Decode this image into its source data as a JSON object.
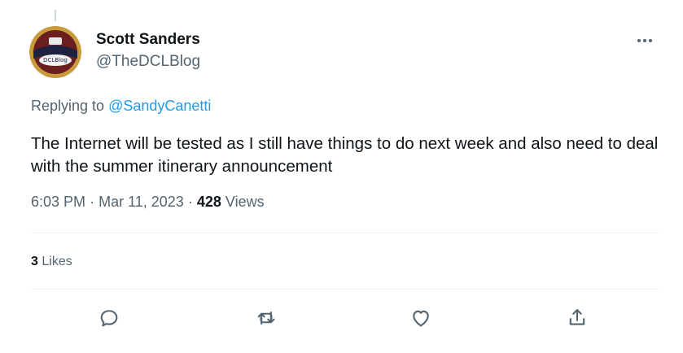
{
  "author": {
    "name": "Scott Sanders",
    "handle": "@TheDCLBlog",
    "avatar_text": "DCLBlog"
  },
  "reply": {
    "prefix": "Replying to",
    "mention": "@SandyCanetti"
  },
  "tweet": {
    "text": "The Internet will be tested as I still have things to do next week and also need to deal with the summer itinerary announcement",
    "time": "6:03 PM",
    "sep1": "·",
    "date": "Mar 11, 2023",
    "sep2": "·",
    "views_count": "428",
    "views_label": "Views"
  },
  "stats": {
    "likes_count": "3",
    "likes_label": "Likes"
  },
  "actions": {
    "reply_icon": "reply-icon",
    "retweet_icon": "retweet-icon",
    "like_icon": "heart-icon",
    "share_icon": "share-icon"
  },
  "colors": {
    "text": "#0f1419",
    "secondary": "#536471",
    "accent": "#1d9bf0",
    "divider": "#eff3f4"
  }
}
